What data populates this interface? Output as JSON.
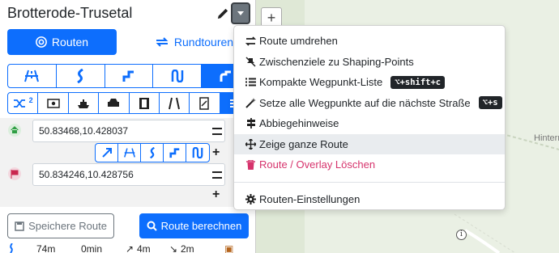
{
  "sidebar": {
    "title": "Brotterode-Trusetal",
    "tabs": {
      "routen": "Routen",
      "rundtouren": "Rundtouren"
    },
    "waypoints": [
      {
        "coords": "50.83468,10.428037",
        "marker": "start"
      },
      {
        "coords": "50.834246,10.428756",
        "marker": "end"
      }
    ],
    "save_label": "Speichere Route",
    "calc_label": "Route berechnen",
    "options_badge": "2",
    "stats": {
      "distance": "74m",
      "time": "0min",
      "ascent": "4m",
      "descent": "2m"
    }
  },
  "menu": {
    "items": [
      {
        "icon": "arrows-swap-icon",
        "label": "Route umdrehen"
      },
      {
        "icon": "map-pin-slash-icon",
        "label": "Zwischenziele zu Shaping-Points"
      },
      {
        "icon": "list-icon",
        "label": "Kompakte Wegpunkt-Liste",
        "shortcut": "⌥+shift+c"
      },
      {
        "icon": "magic-wand-icon",
        "label": "Setze alle Wegpunkte auf die nächste Straße",
        "shortcut": "⌥+s"
      },
      {
        "icon": "signs-icon",
        "label": "Abbiegehinweise"
      },
      {
        "icon": "arrows-move-icon",
        "label": "Zeige ganze Route"
      },
      {
        "icon": "trash-icon",
        "label": "Route / Overlay Löschen"
      },
      {
        "icon": "gear-icon",
        "label": "Routen-Einstellungen"
      }
    ]
  },
  "map": {
    "zoom_in": "+",
    "road_label": "Hinterr",
    "info_marker": "i"
  },
  "colors": {
    "primary": "#0d6efd",
    "danger": "#d6336c",
    "secondary": "#6c757d"
  }
}
